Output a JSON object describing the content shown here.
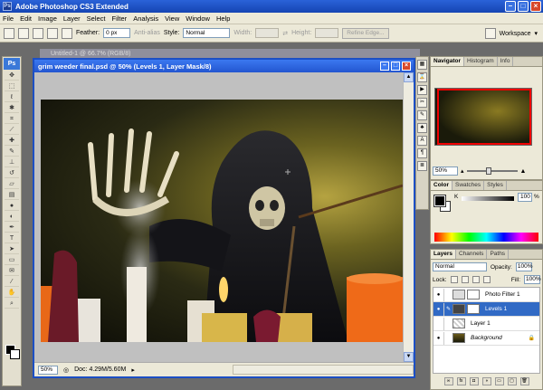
{
  "app": {
    "title": "Adobe Photoshop CS3 Extended"
  },
  "menu": [
    "File",
    "Edit",
    "Image",
    "Layer",
    "Select",
    "Filter",
    "Analysis",
    "View",
    "Window",
    "Help"
  ],
  "options": {
    "feather_label": "Feather:",
    "feather_value": "0 px",
    "antialias_label": "Anti-alias",
    "style_label": "Style:",
    "style_value": "Normal",
    "width_label": "Width:",
    "height_label": "Height:",
    "refine_label": "Refine Edge...",
    "workspace_label": "Workspace"
  },
  "toolbox": {
    "ps_label": "Ps"
  },
  "document": {
    "back_title": "Untitled-1 @ 66.7% (RGB/8)",
    "title": "grim weeder final.psd @ 50% (Levels 1, Layer Mask/8)",
    "zoom": "50%",
    "doc_info": "Doc: 4.29M/5.60M"
  },
  "navigator": {
    "tabs": [
      "Navigator",
      "Histogram",
      "Info"
    ],
    "zoom": "50%",
    "slider_fraction": 0.43
  },
  "color_panel": {
    "tabs": [
      "Color",
      "Swatches",
      "Styles"
    ],
    "channel_label": "K",
    "channel_value": "100",
    "unit": "%"
  },
  "layers_panel": {
    "tabs": [
      "Layers",
      "Channels",
      "Paths"
    ],
    "blend_mode": "Normal",
    "opacity_label": "Opacity:",
    "opacity_value": "100%",
    "lock_label": "Lock:",
    "fill_label": "Fill:",
    "fill_value": "100%",
    "layers": [
      {
        "name": "Photo Filter 1",
        "active": false
      },
      {
        "name": "Levels 1",
        "active": true
      },
      {
        "name": "Layer 1",
        "active": false
      },
      {
        "name": "Background",
        "active": false
      }
    ]
  },
  "colors": {
    "titlebar": "#2356d0",
    "selected_layer": "#316ac5",
    "nav_box": "#e00000"
  }
}
